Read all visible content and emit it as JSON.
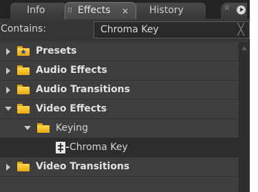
{
  "tabs": {
    "info": "Info",
    "effects": "Effects",
    "history": "History",
    "close_glyph": "×",
    "grip_glyph": "⁝⁝",
    "menu_dots": "⁞⁞"
  },
  "search": {
    "label": "Contains:",
    "value": "Chroma Key",
    "clear_glyph": "╳"
  },
  "tree": {
    "presets": "Presets",
    "audio_effects": "Audio Effects",
    "audio_transitions": "Audio Transitions",
    "video_effects": "Video Effects",
    "keying": "Keying",
    "chroma_key": "Chroma Key",
    "video_transitions": "Video Transitions"
  },
  "colors": {
    "panel": "#393939",
    "folder": "#f2c12e",
    "text": "#e2e2e2"
  },
  "icons": [
    "folder-icon",
    "presets-star-icon",
    "effect-icon",
    "expand-triangle-icon",
    "collapse-triangle-icon",
    "close-icon",
    "panel-menu-icon"
  ]
}
